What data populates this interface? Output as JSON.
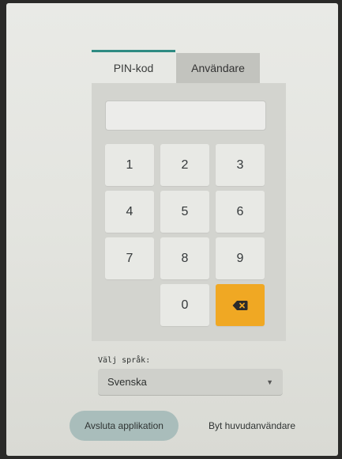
{
  "tabs": [
    {
      "label": "PIN-kod",
      "active": true
    },
    {
      "label": "Användare",
      "active": false
    }
  ],
  "pin_input": {
    "value": "",
    "placeholder": ""
  },
  "keypad": {
    "keys": [
      "1",
      "2",
      "3",
      "4",
      "5",
      "6",
      "7",
      "8",
      "9",
      "0"
    ],
    "backspace_icon": "backspace-icon",
    "accent_color": "#f0a823"
  },
  "language": {
    "label": "Välj språk:",
    "selected": "Svenska"
  },
  "actions": {
    "exit_label": "Avsluta applikation",
    "switch_user_label": "Byt huvudanvändare"
  },
  "colors": {
    "active_tab_indicator": "#2e8b82"
  }
}
